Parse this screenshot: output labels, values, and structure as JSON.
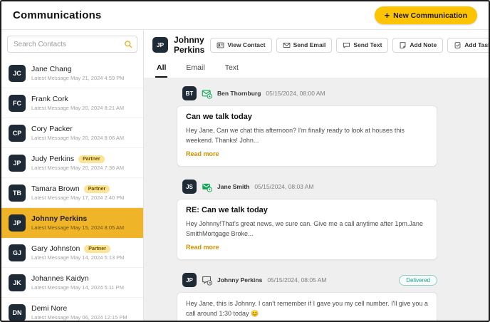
{
  "app": {
    "title": "Communications",
    "new_button": {
      "icon": "+",
      "label": "New Communication"
    }
  },
  "sidebar": {
    "search_placeholder": "Search Contacts",
    "contacts": [
      {
        "initials": "JC",
        "name": "Jane Chang",
        "meta": "Latest Message May 21, 2024 4:59 PM"
      },
      {
        "initials": "FC",
        "name": "Frank Cork",
        "meta": "Latest Message May 20, 2024 8:21 AM"
      },
      {
        "initials": "CP",
        "name": "Cory Packer",
        "meta": "Latest Message May 20, 2024 8:06 AM"
      },
      {
        "initials": "JP",
        "name": "Judy Perkins",
        "badge": "Partner",
        "meta": "Latest Message May 20, 2024 7:36 AM"
      },
      {
        "initials": "TB",
        "name": "Tamara Brown",
        "badge": "Partner",
        "meta": "Latest Message May 17, 2024 2:40 PM"
      },
      {
        "initials": "JP",
        "name": "Johnny Perkins",
        "selected": true,
        "meta": "Latest Message May 15, 2024 8:05 AM"
      },
      {
        "initials": "GJ",
        "name": "Gary Johnston",
        "badge": "Partner",
        "meta": "Latest Message May 14, 2024 5:13 PM"
      },
      {
        "initials": "JK",
        "name": "Johannes Kaidyn",
        "meta": "Latest Message May 14, 2024 5:11 PM"
      },
      {
        "initials": "DN",
        "name": "Demi Nore",
        "meta": "Latest Message May 06, 2024 12:15 PM"
      }
    ]
  },
  "main": {
    "contact": {
      "initials": "JP",
      "name": "Johnny Perkins"
    },
    "actions": [
      {
        "label": "View Contact",
        "icon": "contact-card-icon"
      },
      {
        "label": "Send Email",
        "icon": "envelope-icon"
      },
      {
        "label": "Send Text",
        "icon": "chat-bubble-icon"
      },
      {
        "label": "Add Note",
        "icon": "note-icon"
      },
      {
        "label": "Add Task",
        "icon": "task-icon"
      }
    ],
    "tabs": [
      {
        "label": "All",
        "active": true
      },
      {
        "label": "Email",
        "active": false
      },
      {
        "label": "Text",
        "active": false
      }
    ],
    "messages": [
      {
        "initials": "BT",
        "icon": "email-received-icon",
        "sender": "Ben Thornburg",
        "timestamp": "05/15/2024, 08:00 AM",
        "title": "Can we talk today",
        "body": "Hey Jane, Can we chat this afternoon? I'm finally ready to look at houses this weekend. Thanks! John...",
        "read_more": "Read more"
      },
      {
        "initials": "JS",
        "icon": "email-sent-icon",
        "sender": "Jane Smith",
        "timestamp": "05/15/2024, 08:03 AM",
        "title": "RE: Can we talk today",
        "body": "Hey Johnny!That's great news, we sure can. Give me a call anytime after 1pm.Jane SmithMortgage Broke...",
        "read_more": "Read more"
      },
      {
        "initials": "JP",
        "icon": "text-message-icon",
        "sender": "Johnny Perkins",
        "timestamp": "05/15/2024, 08:05 AM",
        "status": "Delivered",
        "body": "Hey Jane, this is Johnny. I can't remember if I gave you my cell number. I'll give you a call around 1:30 today 😊"
      }
    ]
  },
  "colors": {
    "accent": "#FFC400",
    "selected_contact": "#F0B429",
    "partner_badge": "#FBE497",
    "avatar_bg": "#1F2A37",
    "thread_bg": "#EFEFEF",
    "read_more": "#D19000",
    "delivered": "#1F9E92",
    "email_icon": "#12A454"
  }
}
